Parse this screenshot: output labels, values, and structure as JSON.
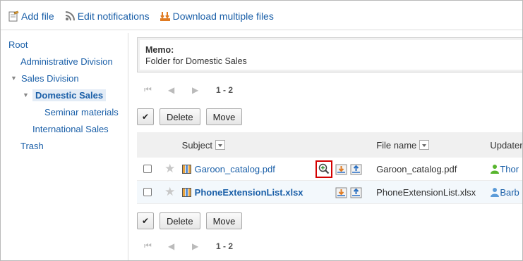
{
  "toolbar": {
    "add_file": "Add file",
    "edit_notifications": "Edit notifications",
    "download_multiple": "Download multiple files"
  },
  "tree": {
    "items": [
      {
        "label": "Root",
        "level": 0,
        "toggle": ""
      },
      {
        "label": "Administrative Division",
        "level": 1,
        "toggle": ""
      },
      {
        "label": "Sales Division",
        "level": 1,
        "toggle": "▼"
      },
      {
        "label": "Domestic Sales",
        "level": 2,
        "toggle": "▼",
        "selected": true
      },
      {
        "label": "Seminar materials",
        "level": 3,
        "toggle": ""
      },
      {
        "label": "International Sales",
        "level": 2,
        "toggle": ""
      },
      {
        "label": "Trash",
        "level": 1,
        "toggle": ""
      }
    ]
  },
  "memo": {
    "title": "Memo:",
    "text": "Folder for Domestic Sales"
  },
  "pager": {
    "range": "1 - 2"
  },
  "actions": {
    "check_all": "✔",
    "delete": "Delete",
    "move": "Move"
  },
  "table": {
    "headers": {
      "subject": "Subject",
      "file_name": "File name",
      "updater": "Updater"
    },
    "rows": [
      {
        "subject": "Garoon_catalog.pdf",
        "file_name": "Garoon_catalog.pdf",
        "updater": "Thor",
        "updater_color": "#58b52d",
        "bold": false
      },
      {
        "subject": "PhoneExtensionList.xlsx",
        "file_name": "PhoneExtensionList.xlsx",
        "updater": "Barb",
        "updater_color": "#5b9bd8",
        "bold": true
      }
    ]
  },
  "icons": {
    "add_file": "add-file-icon",
    "edit_notifications": "notification-icon",
    "download_multiple": "download-multiple-icon",
    "preview": "preview-zoom-icon",
    "download": "download-icon",
    "update": "upload-icon"
  },
  "colors": {
    "link": "#1a5fa8",
    "highlight_border": "#d40000",
    "selected_bg": "#e3ecf6"
  }
}
